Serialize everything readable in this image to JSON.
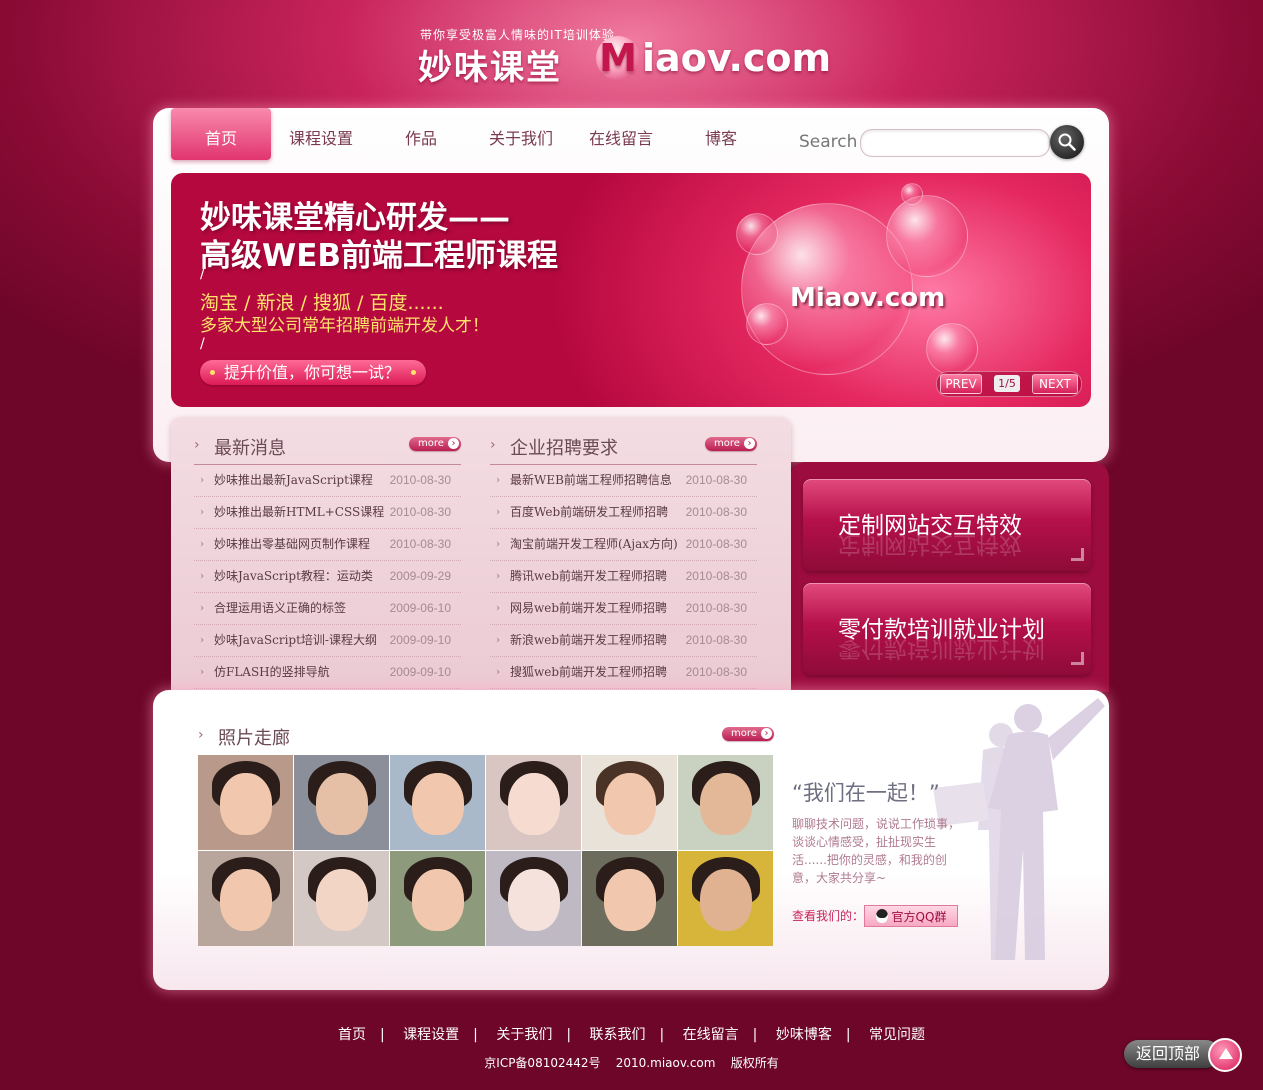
{
  "header": {
    "tagline": "带你享受极富人情味的IT培训体验",
    "brand_cn": "妙味课堂",
    "brand_logo_m": "M",
    "brand_logo_rest": "iaov.com"
  },
  "nav": {
    "items": [
      {
        "label": "首页",
        "active": true
      },
      {
        "label": "课程设置"
      },
      {
        "label": "作品"
      },
      {
        "label": "关于我们"
      },
      {
        "label": "在线留言"
      },
      {
        "label": "博客"
      }
    ],
    "search_label": "Search",
    "search_placeholder": ""
  },
  "banner": {
    "title_line1": "妙味课堂精心研发——",
    "title_line2": "高级WEB前端工程师课程",
    "slash": "/",
    "companies": "淘宝 / 新浪 / 搜狐 / 百度......",
    "subtitle": "多家大型公司常年招聘前端开发人才！",
    "cta": "提升价值，你可想一试？",
    "logo": "Miaov.com",
    "prev": "PREV",
    "page": "1/5",
    "next": "NEXT"
  },
  "news": {
    "title": "最新消息",
    "more": "more",
    "arrow": "›",
    "items": [
      {
        "title": "妙味推出最新JavaScript课程",
        "date": "2010-08-30"
      },
      {
        "title": "妙味推出最新HTML+CSS课程",
        "date": "2010-08-30"
      },
      {
        "title": "妙味推出零基础网页制作课程",
        "date": "2010-08-30"
      },
      {
        "title": "妙味JavaScript教程：运动类",
        "date": "2009-09-29"
      },
      {
        "title": "合理运用语义正确的标签",
        "date": "2009-06-10"
      },
      {
        "title": "妙味JavaScript培训-课程大纲",
        "date": "2009-09-10"
      },
      {
        "title": "仿FLASH的竖排导航",
        "date": "2009-09-10"
      }
    ]
  },
  "jobs": {
    "title": "企业招聘要求",
    "more": "more",
    "items": [
      {
        "title": "最新WEB前端工程师招聘信息",
        "date": "2010-08-30"
      },
      {
        "title": "百度Web前端研发工程师招聘",
        "date": "2010-08-30"
      },
      {
        "title": "淘宝前端开发工程师(Ajax方向)",
        "date": "2010-08-30"
      },
      {
        "title": "腾讯web前端开发工程师招聘",
        "date": "2010-08-30"
      },
      {
        "title": "网易web前端开发工程师招聘",
        "date": "2010-08-30"
      },
      {
        "title": "新浪web前端开发工程师招聘",
        "date": "2010-08-30"
      },
      {
        "title": "搜狐web前端开发工程师招聘",
        "date": "2010-08-30"
      }
    ]
  },
  "promo": {
    "item1": "定制网站交互特效",
    "item2": "零付款培训就业计划"
  },
  "gallery": {
    "title": "照片走廊",
    "more": "more",
    "together_title": "“我们在一起！”",
    "together_desc": "聊聊技术问题，说说工作琐事，谈谈心情感受，扯扯现实生活......把你的灵感，和我的创意，大家共分享~",
    "qq_label": "查看我们的：",
    "qq_button": "官方QQ群"
  },
  "footer": {
    "links": [
      "首页",
      "课程设置",
      "关于我们",
      "联系我们",
      "在线留言",
      "妙味博客",
      "常见问题"
    ],
    "separator": "|",
    "copyright": "京ICP备08102442号    2010.miaov.com    版权所有",
    "back_to_top": "返回顶部"
  },
  "colors": {
    "brand": "#c4154c",
    "background": "#8a0b35",
    "accent_yellow": "#ffe36a"
  }
}
